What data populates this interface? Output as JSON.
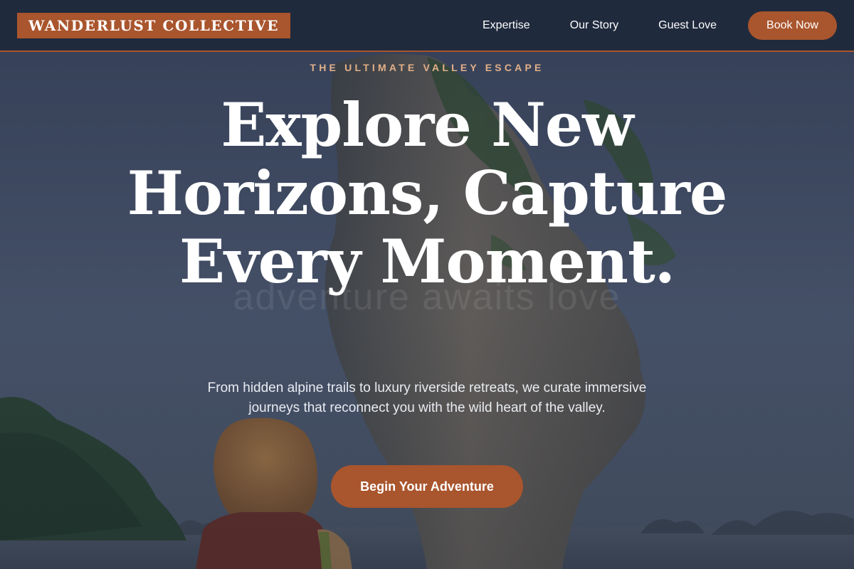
{
  "nav": {
    "brand": "WANDERLUST COLLECTIVE",
    "links": [
      "Expertise",
      "Our Story",
      "Guest Love"
    ],
    "cta_label": "Book Now"
  },
  "hero": {
    "eyebrow": "THE ULTIMATE VALLEY ESCAPE",
    "headline": "Explore New Horizons, Capture Every Moment.",
    "watermark": "adventure awaits love",
    "subtext": "From hidden alpine trails to luxury riverside retreats, we curate immersive journeys that reconnect you with the wild heart of the valley.",
    "cta_label": "Begin Your Adventure"
  },
  "colors": {
    "accent": "#a9552d",
    "nav_background": "#1f2a3d",
    "eyebrow": "#e2b089",
    "text": "#ffffff"
  }
}
